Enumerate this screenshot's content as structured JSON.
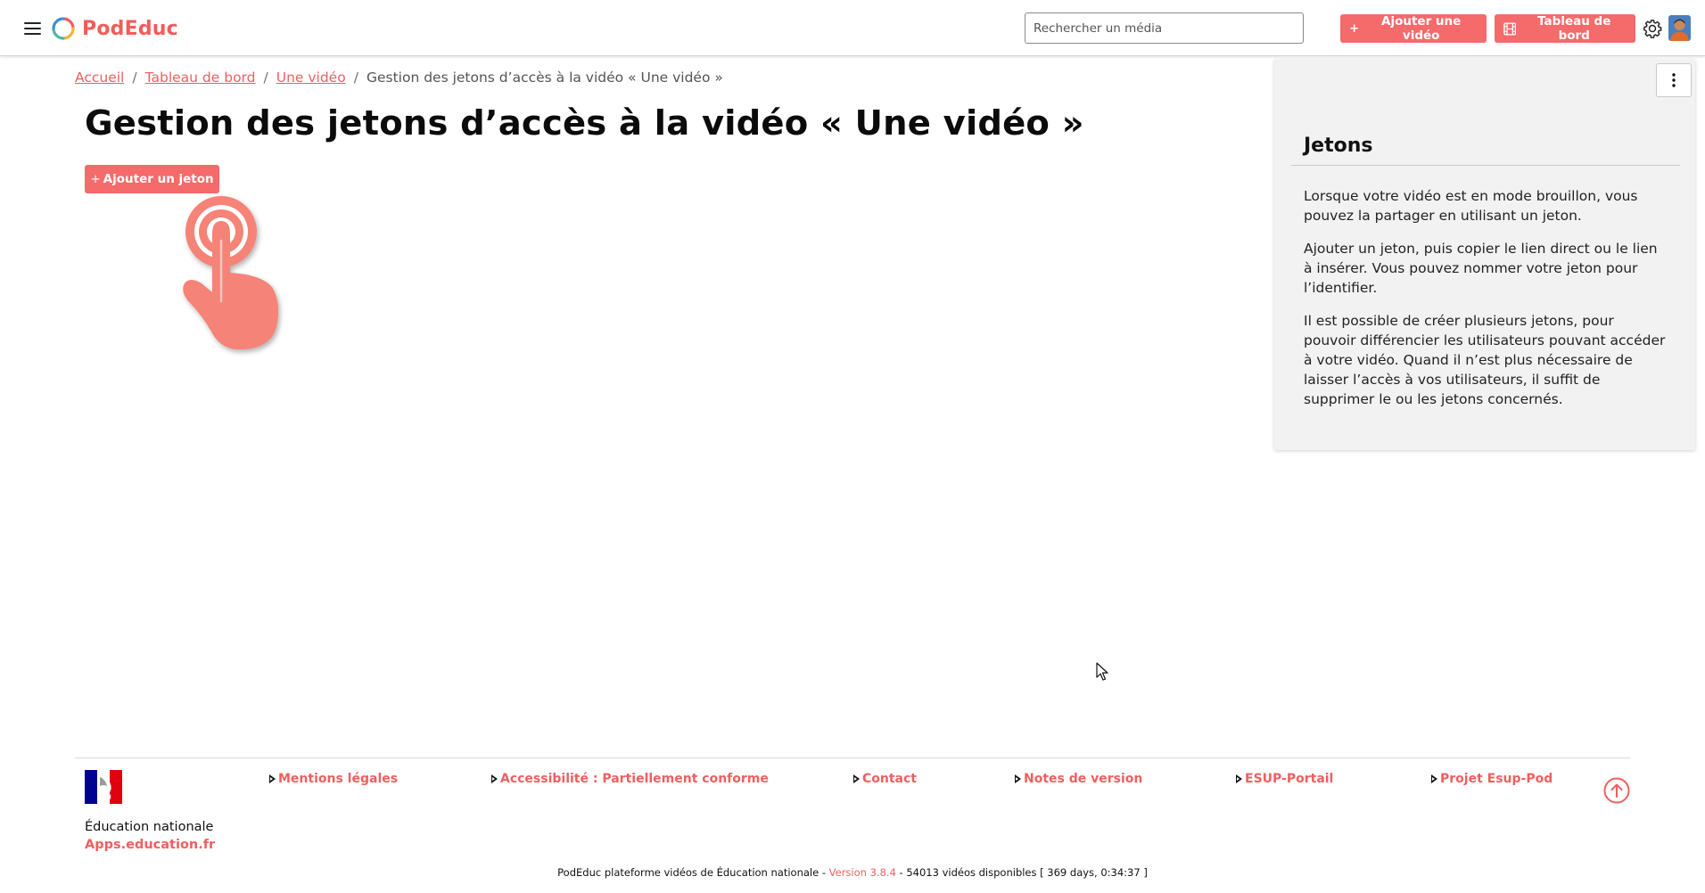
{
  "navbar": {
    "brand": "PodEduc",
    "search_placeholder": "Rechercher un média",
    "add_video_label": "Ajouter une vidéo",
    "dashboard_label": "Tableau de bord",
    "accent": "#f56a6a"
  },
  "breadcrumb": {
    "items": [
      "Accueil",
      "Tableau de bord",
      "Une vidéo"
    ],
    "current": "Gestion des jetons d’accès à la vidéo « Une vidéo »"
  },
  "main": {
    "title": "Gestion des jetons d’accès à la vidéo « Une vidéo »",
    "add_token_label": "Ajouter un jeton"
  },
  "aside": {
    "title": "Jetons",
    "paragraphs": [
      "Lorsque votre vidéo est en mode brouillon, vous pouvez la partager en utilisant un jeton.",
      "Ajouter un jeton, puis copier le lien direct ou le lien à insérer. Vous pouvez nommer votre jeton pour l’identifier.",
      "Il est possible de créer plusieurs jetons, pour pouvoir différencier les utilisateurs pouvant accéder à votre vidéo. Quand il n’est plus nécessaire de laisser l’accès à vos utilisateurs, il suffit de supprimer le ou les jetons concernés."
    ]
  },
  "footer": {
    "org_name": "Éducation nationale",
    "org_link": "Apps.education.fr",
    "links": [
      "Mentions légales",
      "Accessibilité : Partiellement conforme",
      "Contact",
      "Notes de version",
      "ESUP-Portail",
      "Projet Esup-Pod"
    ],
    "bottom_prefix": "PodEduc plateforme vidéos de Éducation nationale - ",
    "version": "Version 3.8.4",
    "bottom_suffix": " - 54013 vidéos disponibles [ 369 days, 0:34:37 ]"
  }
}
